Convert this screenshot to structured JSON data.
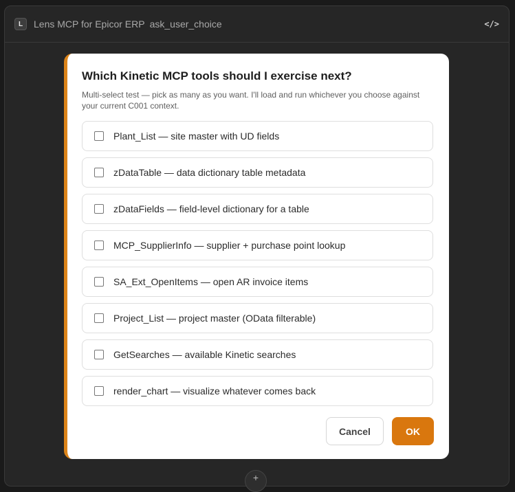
{
  "header": {
    "badge": "L",
    "title": "Lens MCP for Epicor ERP",
    "tool_name": "ask_user_choice",
    "code_icon": "</>"
  },
  "dialog": {
    "title": "Which Kinetic MCP tools should I exercise next?",
    "subtitle": "Multi-select test — pick as many as you want. I'll load and run whichever you choose against your current C001 context.",
    "options": [
      {
        "label": "Plant_List — site master with UD fields",
        "checked": false
      },
      {
        "label": "zDataTable — data dictionary table metadata",
        "checked": false
      },
      {
        "label": "zDataFields — field-level dictionary for a table",
        "checked": false
      },
      {
        "label": "MCP_SupplierInfo — supplier + purchase point lookup",
        "checked": false
      },
      {
        "label": "SA_Ext_OpenItems — open AR invoice items",
        "checked": false
      },
      {
        "label": "Project_List — project master (OData filterable)",
        "checked": false
      },
      {
        "label": "GetSearches — available Kinetic searches",
        "checked": false
      },
      {
        "label": "render_chart — visualize whatever comes back",
        "checked": false
      }
    ],
    "cancel_label": "Cancel",
    "ok_label": "OK"
  },
  "bottom": {
    "icon": "+"
  },
  "colors": {
    "accent": "#d9770e",
    "background": "#1a1a1a",
    "panel": "#262626"
  }
}
